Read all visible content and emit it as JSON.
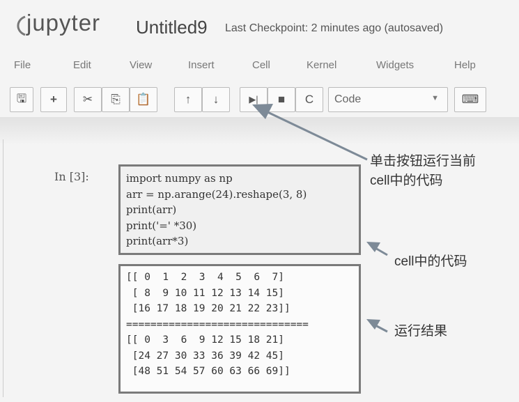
{
  "header": {
    "brand": "jupyter",
    "notebook_name": "Untitled9",
    "checkpoint": "Last Checkpoint: 2 minutes ago (autosaved)"
  },
  "menu": [
    "File",
    "Edit",
    "View",
    "Insert",
    "Cell",
    "Kernel",
    "Widgets",
    "Help"
  ],
  "toolbar": {
    "buttons": [
      {
        "name": "save-icon",
        "glyph": "🖫"
      },
      {
        "name": "add-cell-icon",
        "glyph": "+"
      },
      {
        "name": "cut-icon",
        "glyph": "✂"
      },
      {
        "name": "copy-icon",
        "glyph": "⎘"
      },
      {
        "name": "paste-icon",
        "glyph": "📋"
      },
      {
        "name": "move-up-icon",
        "glyph": "↑"
      },
      {
        "name": "move-down-icon",
        "glyph": "↓"
      },
      {
        "name": "run-icon",
        "glyph": "▶|"
      },
      {
        "name": "stop-icon",
        "glyph": "■"
      },
      {
        "name": "restart-icon",
        "glyph": "C"
      },
      {
        "name": "keyboard-icon",
        "glyph": "⌨"
      }
    ],
    "cell_type": "Code"
  },
  "cell": {
    "prompt": "In  [3]:",
    "code": [
      "import numpy as np",
      "arr = np.arange(24).reshape(3, 8)",
      "print(arr)",
      "print('=' *30)",
      "print(arr*3)"
    ],
    "output": [
      "[[ 0  1  2  3  4  5  6  7]",
      " [ 8  9 10 11 12 13 14 15]",
      " [16 17 18 19 20 21 22 23]]",
      "==============================",
      "[[ 0  3  6  9 12 15 18 21]",
      " [24 27 30 33 36 39 42 45]",
      " [48 51 54 57 60 63 66 69]]"
    ]
  },
  "annotations": {
    "run_line1": "单击按钮运行当前",
    "run_line2": "cell中的代码",
    "code_label": "cell中的代码",
    "result_label": "运行结果"
  },
  "colors": {
    "frame": "#7a7a7a",
    "arrow": "#7d8a97"
  }
}
